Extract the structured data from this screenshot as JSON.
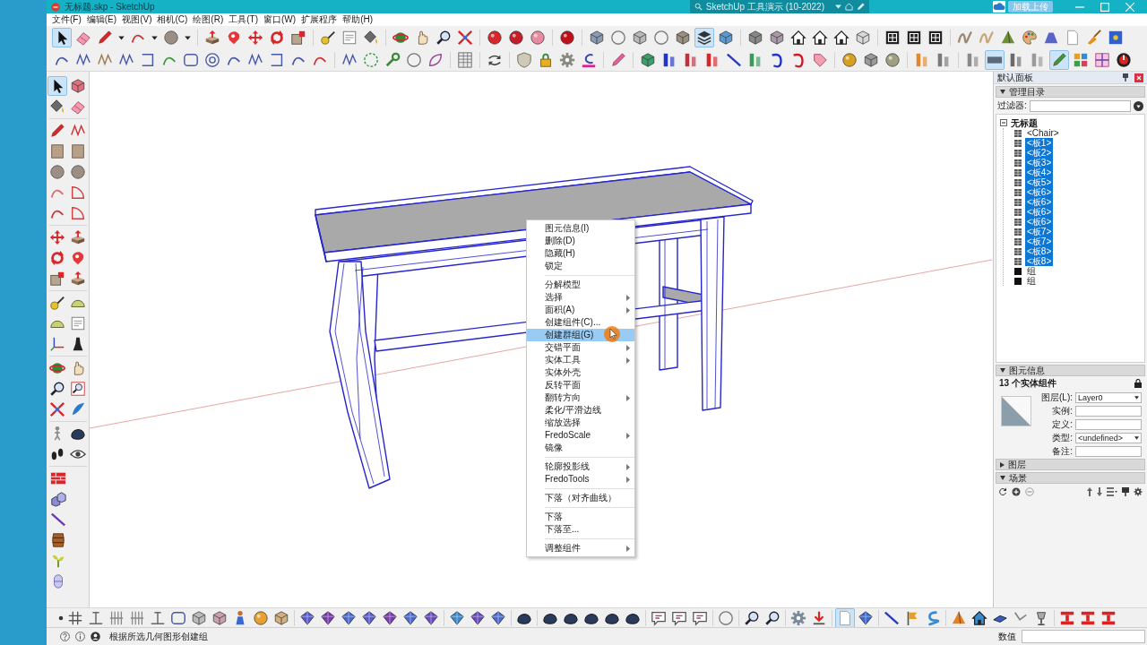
{
  "window": {
    "title": "无标题.skp - SketchUp",
    "document_tab": "SketchUp 工具演示 (10-2022)",
    "account_button": "加载上传"
  },
  "menu_bar": [
    "文件(F)",
    "编辑(E)",
    "视图(V)",
    "相机(C)",
    "绘图(R)",
    "工具(T)",
    "窗口(W)",
    "扩展程序",
    "帮助(H)"
  ],
  "toolbars": {
    "top": [
      {
        "selected": true
      },
      {
        "selected": false
      },
      {
        "selected": false
      },
      {
        "selected": false
      },
      {
        "selected": false
      },
      {
        "selected": false
      },
      {
        "selected": false
      },
      {
        "selected": false
      },
      {
        "selected": false
      },
      {
        "selected": false
      },
      {
        "selected": false
      },
      {
        "selected": false
      },
      {
        "selected": false
      },
      {
        "selected": false
      },
      {
        "selected": false
      },
      {
        "selected": false
      },
      {
        "selected": false
      },
      {
        "selected": false
      },
      {
        "selected": false
      },
      {
        "selected": false
      },
      {
        "selected": false
      },
      {
        "selected": false
      },
      {
        "selected": false
      },
      {
        "selected": false
      },
      {
        "selected": false
      },
      {
        "selected": false
      },
      {
        "selected": false
      },
      {
        "selected": false
      },
      {
        "selected": false
      },
      {
        "selected": true
      },
      {
        "selected": false
      },
      {
        "selected": false
      },
      {
        "selected": false
      },
      {
        "selected": false
      },
      {
        "selected": false
      },
      {
        "selected": false
      },
      {
        "selected": false
      },
      {
        "selected": false
      },
      {
        "selected": false
      },
      {
        "selected": false
      },
      {
        "selected": false
      },
      {
        "selected": false
      },
      {
        "selected": false
      },
      {
        "selected": false
      },
      {
        "selected": false
      },
      {
        "selected": false
      },
      {
        "selected": false
      },
      {
        "selected": false
      }
    ],
    "second": [
      {
        "selected": false
      },
      {
        "selected": false
      },
      {
        "selected": false
      },
      {
        "selected": false
      },
      {
        "selected": false
      },
      {
        "selected": false
      },
      {
        "selected": false
      },
      {
        "selected": false
      },
      {
        "selected": false
      },
      {
        "selected": false
      },
      {
        "selected": false
      },
      {
        "selected": false
      },
      {
        "selected": false
      },
      {
        "selected": false
      },
      {
        "selected": false
      },
      {
        "selected": false
      },
      {
        "selected": false
      },
      {
        "selected": false
      },
      {
        "selected": false
      },
      {
        "selected": false
      },
      {
        "selected": false
      },
      {
        "selected": false
      },
      {
        "selected": false
      },
      {
        "selected": false
      },
      {
        "selected": false
      },
      {
        "selected": false
      },
      {
        "selected": false
      },
      {
        "selected": false
      },
      {
        "selected": false
      },
      {
        "selected": false
      },
      {
        "selected": false
      },
      {
        "selected": false
      },
      {
        "selected": false
      },
      {
        "selected": false
      },
      {
        "selected": false
      },
      {
        "selected": false
      },
      {
        "selected": false
      },
      {
        "selected": false
      },
      {
        "selected": false
      },
      {
        "selected": false
      },
      {
        "selected": true
      },
      {
        "selected": false
      },
      {
        "selected": false
      },
      {
        "selected": true
      },
      {
        "selected": false
      },
      {
        "selected": false
      },
      {
        "selected": false
      }
    ],
    "left": [
      {
        "selected": true
      },
      {
        "selected": false
      },
      {
        "selected": false
      },
      {
        "selected": false
      },
      {
        "selected": false
      },
      {
        "selected": false
      },
      {
        "selected": false
      },
      {
        "selected": false
      },
      {
        "selected": false
      },
      {
        "selected": false
      },
      {
        "selected": false
      },
      {
        "selected": false
      },
      {
        "selected": false
      },
      {
        "selected": false
      },
      {
        "selected": false
      },
      {
        "selected": false
      },
      {
        "selected": false
      },
      {
        "selected": false
      },
      {
        "selected": false
      },
      {
        "selected": false
      },
      {
        "selected": false
      },
      {
        "selected": false
      },
      {
        "selected": false
      },
      {
        "selected": false
      },
      {
        "selected": false
      },
      {
        "selected": false
      },
      {
        "selected": false
      },
      {
        "selected": false
      },
      {
        "selected": false
      },
      {
        "selected": false
      },
      {
        "selected": false
      },
      {
        "selected": false
      },
      {
        "selected": false
      },
      {
        "selected": false
      },
      {
        "selected": false
      },
      {
        "selected": false
      },
      {
        "selected": false
      },
      {
        "selected": false
      },
      {
        "selected": false
      },
      {
        "selected": false
      },
      {
        "selected": false
      },
      {
        "selected": false
      }
    ],
    "bottom": [
      {
        "selected": false
      },
      {
        "selected": false
      },
      {
        "selected": false
      },
      {
        "selected": false
      },
      {
        "selected": false
      },
      {
        "selected": false
      },
      {
        "selected": false
      },
      {
        "selected": false
      },
      {
        "selected": false
      },
      {
        "selected": false
      },
      {
        "selected": false
      },
      {
        "selected": false
      },
      {
        "selected": false
      },
      {
        "selected": false
      },
      {
        "selected": false
      },
      {
        "selected": false
      },
      {
        "selected": false
      },
      {
        "selected": false
      },
      {
        "selected": false
      },
      {
        "selected": false
      },
      {
        "selected": false
      },
      {
        "selected": false
      },
      {
        "selected": false
      },
      {
        "selected": false
      },
      {
        "selected": false
      },
      {
        "selected": false
      },
      {
        "selected": false
      },
      {
        "selected": false
      },
      {
        "selected": false
      },
      {
        "selected": false
      },
      {
        "selected": false
      },
      {
        "selected": false
      },
      {
        "selected": false
      },
      {
        "selected": false
      },
      {
        "selected": false
      },
      {
        "selected": false
      },
      {
        "selected": true
      },
      {
        "selected": false
      },
      {
        "selected": false
      },
      {
        "selected": false
      },
      {
        "selected": false
      },
      {
        "selected": false
      },
      {
        "selected": false
      },
      {
        "selected": false
      },
      {
        "selected": false
      },
      {
        "selected": false
      },
      {
        "selected": false
      },
      {
        "selected": false
      },
      {
        "selected": false
      }
    ]
  },
  "context_menu": {
    "groups": [
      [
        {
          "label": "图元信息(I)",
          "submenu": false,
          "selected": false
        },
        {
          "label": "删除(D)",
          "submenu": false,
          "selected": false
        },
        {
          "label": "隐藏(H)",
          "submenu": false,
          "selected": false
        },
        {
          "label": "锁定",
          "submenu": false,
          "selected": false
        }
      ],
      [
        {
          "label": "分解模型",
          "submenu": false,
          "selected": false
        },
        {
          "label": "选择",
          "submenu": true,
          "selected": false
        },
        {
          "label": "面积(A)",
          "submenu": true,
          "selected": false
        },
        {
          "label": "创建组件(C)...",
          "submenu": false,
          "selected": false
        },
        {
          "label": "创建群组(G)",
          "submenu": false,
          "selected": true
        },
        {
          "label": "交错平面",
          "submenu": true,
          "selected": false
        },
        {
          "label": "实体工具",
          "submenu": true,
          "selected": false
        },
        {
          "label": "实体外壳",
          "submenu": false,
          "selected": false
        },
        {
          "label": "反转平面",
          "submenu": false,
          "selected": false
        },
        {
          "label": "翻转方向",
          "submenu": true,
          "selected": false
        },
        {
          "label": "柔化/平滑边线",
          "submenu": false,
          "selected": false
        },
        {
          "label": "缩放选择",
          "submenu": false,
          "selected": false
        },
        {
          "label": "FredoScale",
          "submenu": true,
          "selected": false
        },
        {
          "label": "镜像",
          "submenu": false,
          "selected": false
        }
      ],
      [
        {
          "label": "轮廓投影线",
          "submenu": true,
          "selected": false
        },
        {
          "label": "FredoTools",
          "submenu": true,
          "selected": false
        }
      ],
      [
        {
          "label": "下落（对齐曲线）",
          "submenu": false,
          "selected": false
        }
      ],
      [
        {
          "label": "下落",
          "submenu": false,
          "selected": false
        },
        {
          "label": "下落至...",
          "submenu": false,
          "selected": false
        }
      ],
      [
        {
          "label": "调整组件",
          "submenu": true,
          "selected": false
        }
      ]
    ]
  },
  "tray": {
    "title": "默认面板",
    "outliner": {
      "title": "管理目录",
      "expanded": true,
      "filter_label": "过滤器:",
      "tree": {
        "label": "无标题",
        "expanded": true,
        "children": [
          {
            "label": "<Chair>",
            "kind": "component",
            "selected": false
          },
          {
            "label": "<板1>",
            "kind": "component",
            "selected": true
          },
          {
            "label": "<板2>",
            "kind": "component",
            "selected": true
          },
          {
            "label": "<板3>",
            "kind": "component",
            "selected": true
          },
          {
            "label": "<板4>",
            "kind": "component",
            "selected": true
          },
          {
            "label": "<板5>",
            "kind": "component",
            "selected": true
          },
          {
            "label": "<板6>",
            "kind": "component",
            "selected": true
          },
          {
            "label": "<板6>",
            "kind": "component",
            "selected": true
          },
          {
            "label": "<板6>",
            "kind": "component",
            "selected": true
          },
          {
            "label": "<板6>",
            "kind": "component",
            "selected": true
          },
          {
            "label": "<板7>",
            "kind": "component",
            "selected": true
          },
          {
            "label": "<板7>",
            "kind": "component",
            "selected": true
          },
          {
            "label": "<板8>",
            "kind": "component",
            "selected": true
          },
          {
            "label": "<板8>",
            "kind": "component",
            "selected": true
          },
          {
            "label": "组",
            "kind": "group",
            "selected": false
          },
          {
            "label": "组",
            "kind": "group",
            "selected": false
          }
        ]
      }
    },
    "entity_info": {
      "title": "图元信息",
      "expanded": true,
      "summary": "13 个实体组件",
      "fields": [
        {
          "label": "图层(L):",
          "kind": "select",
          "value": "Layer0"
        },
        {
          "label": "实例:",
          "kind": "text"
        },
        {
          "label": "定义:",
          "kind": "text"
        },
        {
          "label": "类型:",
          "kind": "select",
          "value": "<undefined>"
        },
        {
          "label": "备注:",
          "kind": "text"
        }
      ]
    },
    "layers": {
      "title": "图层",
      "expanded": false
    },
    "scenes": {
      "title": "场景",
      "expanded": true
    }
  },
  "status_bar": {
    "message": "根据所选几何图形创建组",
    "measurements_label": "数值"
  }
}
